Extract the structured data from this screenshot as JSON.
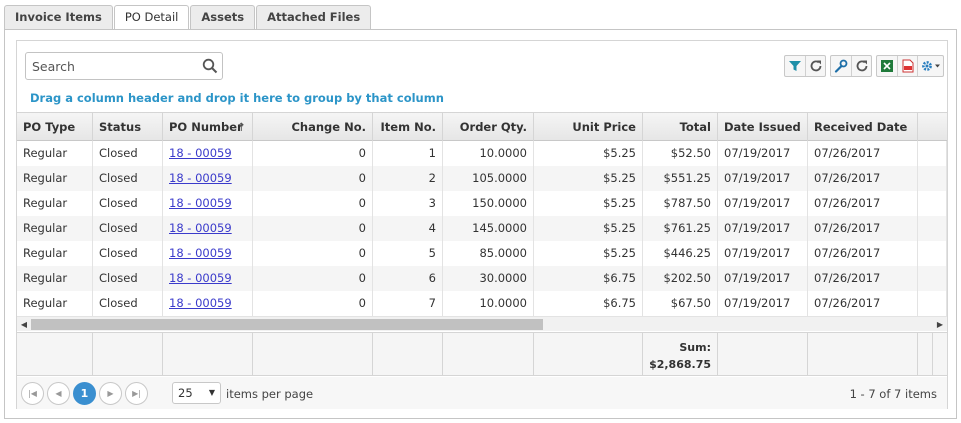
{
  "tabs": [
    {
      "label": "Invoice Items"
    },
    {
      "label": "PO Detail"
    },
    {
      "label": "Assets"
    },
    {
      "label": "Attached Files"
    }
  ],
  "active_tab": "PO Detail",
  "search": {
    "placeholder": "Search"
  },
  "group_hint": "Drag a column header and drop it here to group by that column",
  "toolbar": {
    "icons": [
      "filter-icon",
      "refresh-icon",
      "wrench-icon",
      "refresh-icon",
      "excel-icon",
      "pdf-icon",
      "gear-icon"
    ]
  },
  "columns": [
    {
      "label": "PO Type"
    },
    {
      "label": "Status"
    },
    {
      "label": "PO Number",
      "sort": "↑"
    },
    {
      "label": "Change No."
    },
    {
      "label": "Item No."
    },
    {
      "label": "Order Qty."
    },
    {
      "label": "Unit Price"
    },
    {
      "label": "Total"
    },
    {
      "label": "Date Issued"
    },
    {
      "label": "Received Date"
    }
  ],
  "rows": [
    [
      "Regular",
      "Closed",
      "18 - 00059",
      "0",
      "1",
      "10.0000",
      "$5.25",
      "$52.50",
      "07/19/2017",
      "07/26/2017"
    ],
    [
      "Regular",
      "Closed",
      "18 - 00059",
      "0",
      "2",
      "105.0000",
      "$5.25",
      "$551.25",
      "07/19/2017",
      "07/26/2017"
    ],
    [
      "Regular",
      "Closed",
      "18 - 00059",
      "0",
      "3",
      "150.0000",
      "$5.25",
      "$787.50",
      "07/19/2017",
      "07/26/2017"
    ],
    [
      "Regular",
      "Closed",
      "18 - 00059",
      "0",
      "4",
      "145.0000",
      "$5.25",
      "$761.25",
      "07/19/2017",
      "07/26/2017"
    ],
    [
      "Regular",
      "Closed",
      "18 - 00059",
      "0",
      "5",
      "85.0000",
      "$5.25",
      "$446.25",
      "07/19/2017",
      "07/26/2017"
    ],
    [
      "Regular",
      "Closed",
      "18 - 00059",
      "0",
      "6",
      "30.0000",
      "$6.75",
      "$202.50",
      "07/19/2017",
      "07/26/2017"
    ],
    [
      "Regular",
      "Closed",
      "18 - 00059",
      "0",
      "7",
      "10.0000",
      "$6.75",
      "$67.50",
      "07/19/2017",
      "07/26/2017"
    ]
  ],
  "footer": {
    "sum_label": "Sum:",
    "sum_value": "$2,868.75"
  },
  "pager": {
    "current_page": "1",
    "page_size": "25",
    "items_per_page_label": "items per page",
    "info": "1 - 7 of 7 items"
  },
  "colors": {
    "accent": "#3a8fd0",
    "link": "#3a3acb",
    "hint": "#2c95c8"
  }
}
